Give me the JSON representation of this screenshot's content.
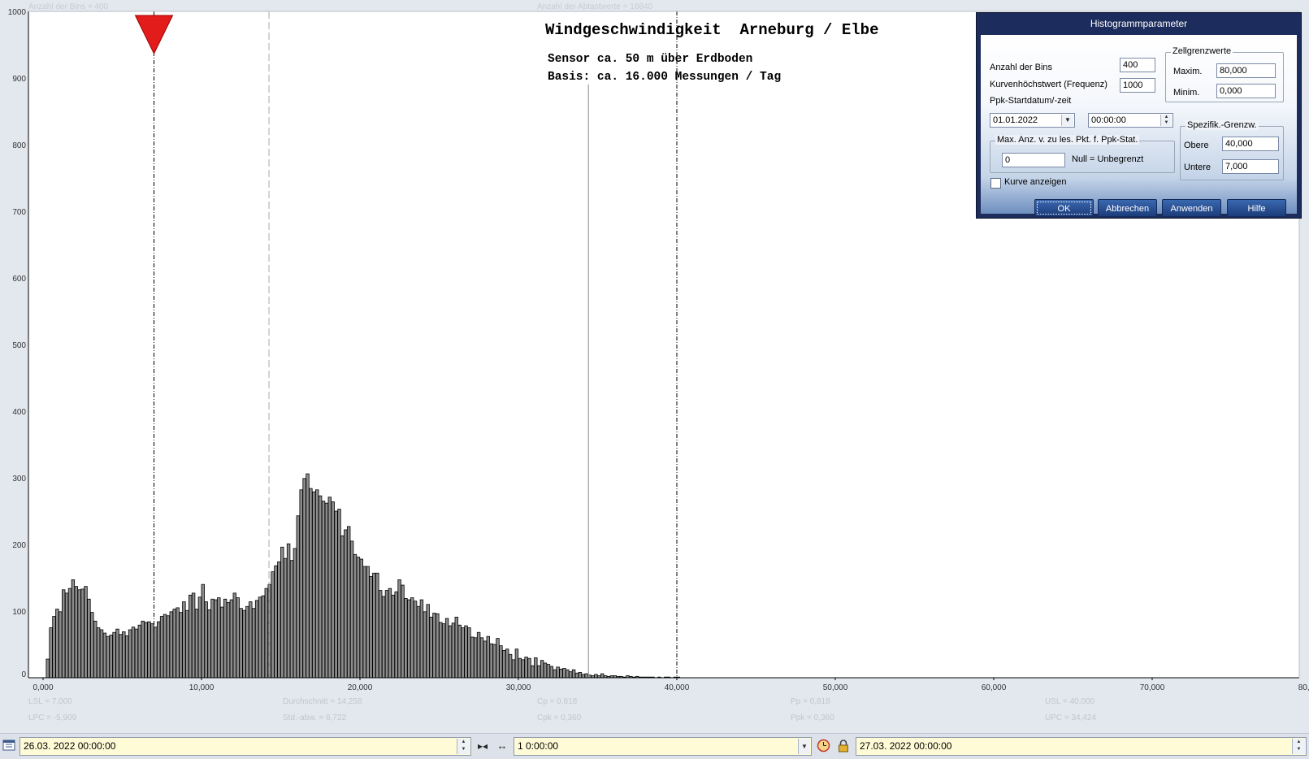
{
  "header": {
    "bins_info": "Anzahl der Bins =   400",
    "samples_info": "Anzahl der Abtastwerte = 16840"
  },
  "chart_data": {
    "type": "bar",
    "title": "Windgeschwindigkeit  Arneburg / Elbe",
    "subtitle_1": "Sensor ca. 50 m über Erdboden",
    "subtitle_2": "Basis: ca. 16.000 Messungen / Tag",
    "xlim": [
      0,
      80
    ],
    "ylim": [
      0,
      1000
    ],
    "grid": false,
    "bin_width": 0.2,
    "bin_start": 0.2,
    "x_tick_labels": [
      "0,000",
      "10,000",
      "20,000",
      "30,000",
      "40,000",
      "50,000",
      "60,000",
      "70,000",
      "80,000"
    ],
    "y_tick_labels": [
      "0",
      "100",
      "200",
      "300",
      "400",
      "500",
      "600",
      "700",
      "800",
      "900",
      "1000"
    ],
    "values": [
      28,
      75,
      92,
      103,
      99,
      132,
      127,
      134,
      147,
      137,
      132,
      133,
      137,
      118,
      98,
      85,
      75,
      72,
      67,
      62,
      64,
      68,
      73,
      65,
      69,
      63,
      72,
      76,
      73,
      79,
      85,
      83,
      84,
      81,
      76,
      84,
      92,
      95,
      93,
      99,
      103,
      105,
      98,
      114,
      101,
      124,
      127,
      103,
      121,
      140,
      114,
      102,
      118,
      117,
      120,
      106,
      118,
      113,
      117,
      127,
      120,
      104,
      101,
      107,
      114,
      104,
      116,
      121,
      123,
      134,
      140,
      159,
      168,
      174,
      196,
      179,
      201,
      176,
      194,
      243,
      282,
      299,
      306,
      284,
      279,
      282,
      273,
      265,
      262,
      271,
      264,
      250,
      253,
      213,
      222,
      227,
      205,
      185,
      181,
      178,
      167,
      167,
      152,
      157,
      157,
      131,
      122,
      131,
      134,
      124,
      129,
      147,
      139,
      119,
      117,
      120,
      115,
      107,
      117,
      99,
      110,
      91,
      97,
      96,
      83,
      81,
      89,
      78,
      82,
      91,
      79,
      75,
      78,
      75,
      61,
      60,
      68,
      60,
      55,
      62,
      51,
      50,
      59,
      48,
      41,
      43,
      35,
      27,
      43,
      29,
      27,
      31,
      29,
      18,
      30,
      18,
      26,
      22,
      20,
      17,
      12,
      16,
      13,
      14,
      12,
      9,
      12,
      7,
      8,
      5,
      6,
      4,
      3,
      5,
      3,
      6,
      3,
      2,
      3,
      3,
      2,
      2,
      1,
      3,
      2,
      1,
      2,
      1,
      1,
      1,
      1,
      1,
      0,
      1,
      0,
      1,
      1,
      0,
      1,
      1
    ],
    "reference_lines": [
      {
        "name": "LSL",
        "x": 7.0,
        "style": "dash-dot"
      },
      {
        "name": "Durchschnitt",
        "x": 14.258,
        "style": "dashed-light"
      },
      {
        "name": "Median",
        "x": 34.424,
        "style": "solid-gray"
      },
      {
        "name": "USL",
        "x": 40.0,
        "style": "dash-dot"
      }
    ],
    "marker_x": 7.0,
    "colors": {
      "bar_fill": "#8c8c8c",
      "bar_edge": "#000000",
      "marker": "#e21b1b",
      "axis": "#000000",
      "tick_text": "#333333"
    }
  },
  "stats": {
    "col1": {
      "a": "LSL = 7,000",
      "b": "LPC = -5,909"
    },
    "col2": {
      "a": "Durchschnitt  = 14,258",
      "b": "Std.-abw. = 6,722"
    },
    "col3": {
      "a": "Cp  = 0,818",
      "b": "Cpk = 0,360"
    },
    "col4": {
      "a": "Pp  = 0,818",
      "b": "Ppk = 0,360"
    },
    "col5": {
      "a": "USL = 40,000",
      "b": "UPC = 34,424"
    }
  },
  "dialog": {
    "title": "Histogrammparameter",
    "bins_label": "Anzahl der Bins",
    "bins_value": "400",
    "curve_max_label": "Kurvenhöchstwert (Frequenz)",
    "curve_max_value": "1000",
    "ppk_start_label": "Ppk-Startdatum/-zeit",
    "ppk_date": "01.01.2022",
    "ppk_time": "00:00:00",
    "cell_limits_group": "Zellgrenzwerte",
    "max_label": "Maxim.",
    "max_value": "80,000",
    "min_label": "Minim.",
    "min_value": "0,000",
    "maxcount_group": "Max. Anz. v. zu les. Pkt. f. Ppk-Stat.",
    "maxcount_value": "0",
    "maxcount_hint": "Null = Unbegrenzt",
    "spec_group": "Spezifik.-Grenzw.",
    "upper_label": "Obere",
    "upper_value": "40,000",
    "lower_label": "Untere",
    "lower_value": "7,000",
    "show_curve_label": "Kurve anzeigen",
    "btn_ok": "OK",
    "btn_cancel": "Abbrechen",
    "btn_apply": "Anwenden",
    "btn_help": "Hilfe"
  },
  "bottombar": {
    "start": "26.03. 2022   00:00:00",
    "interval": "1 0:00:00",
    "end": "27.03. 2022   00:00:00"
  }
}
